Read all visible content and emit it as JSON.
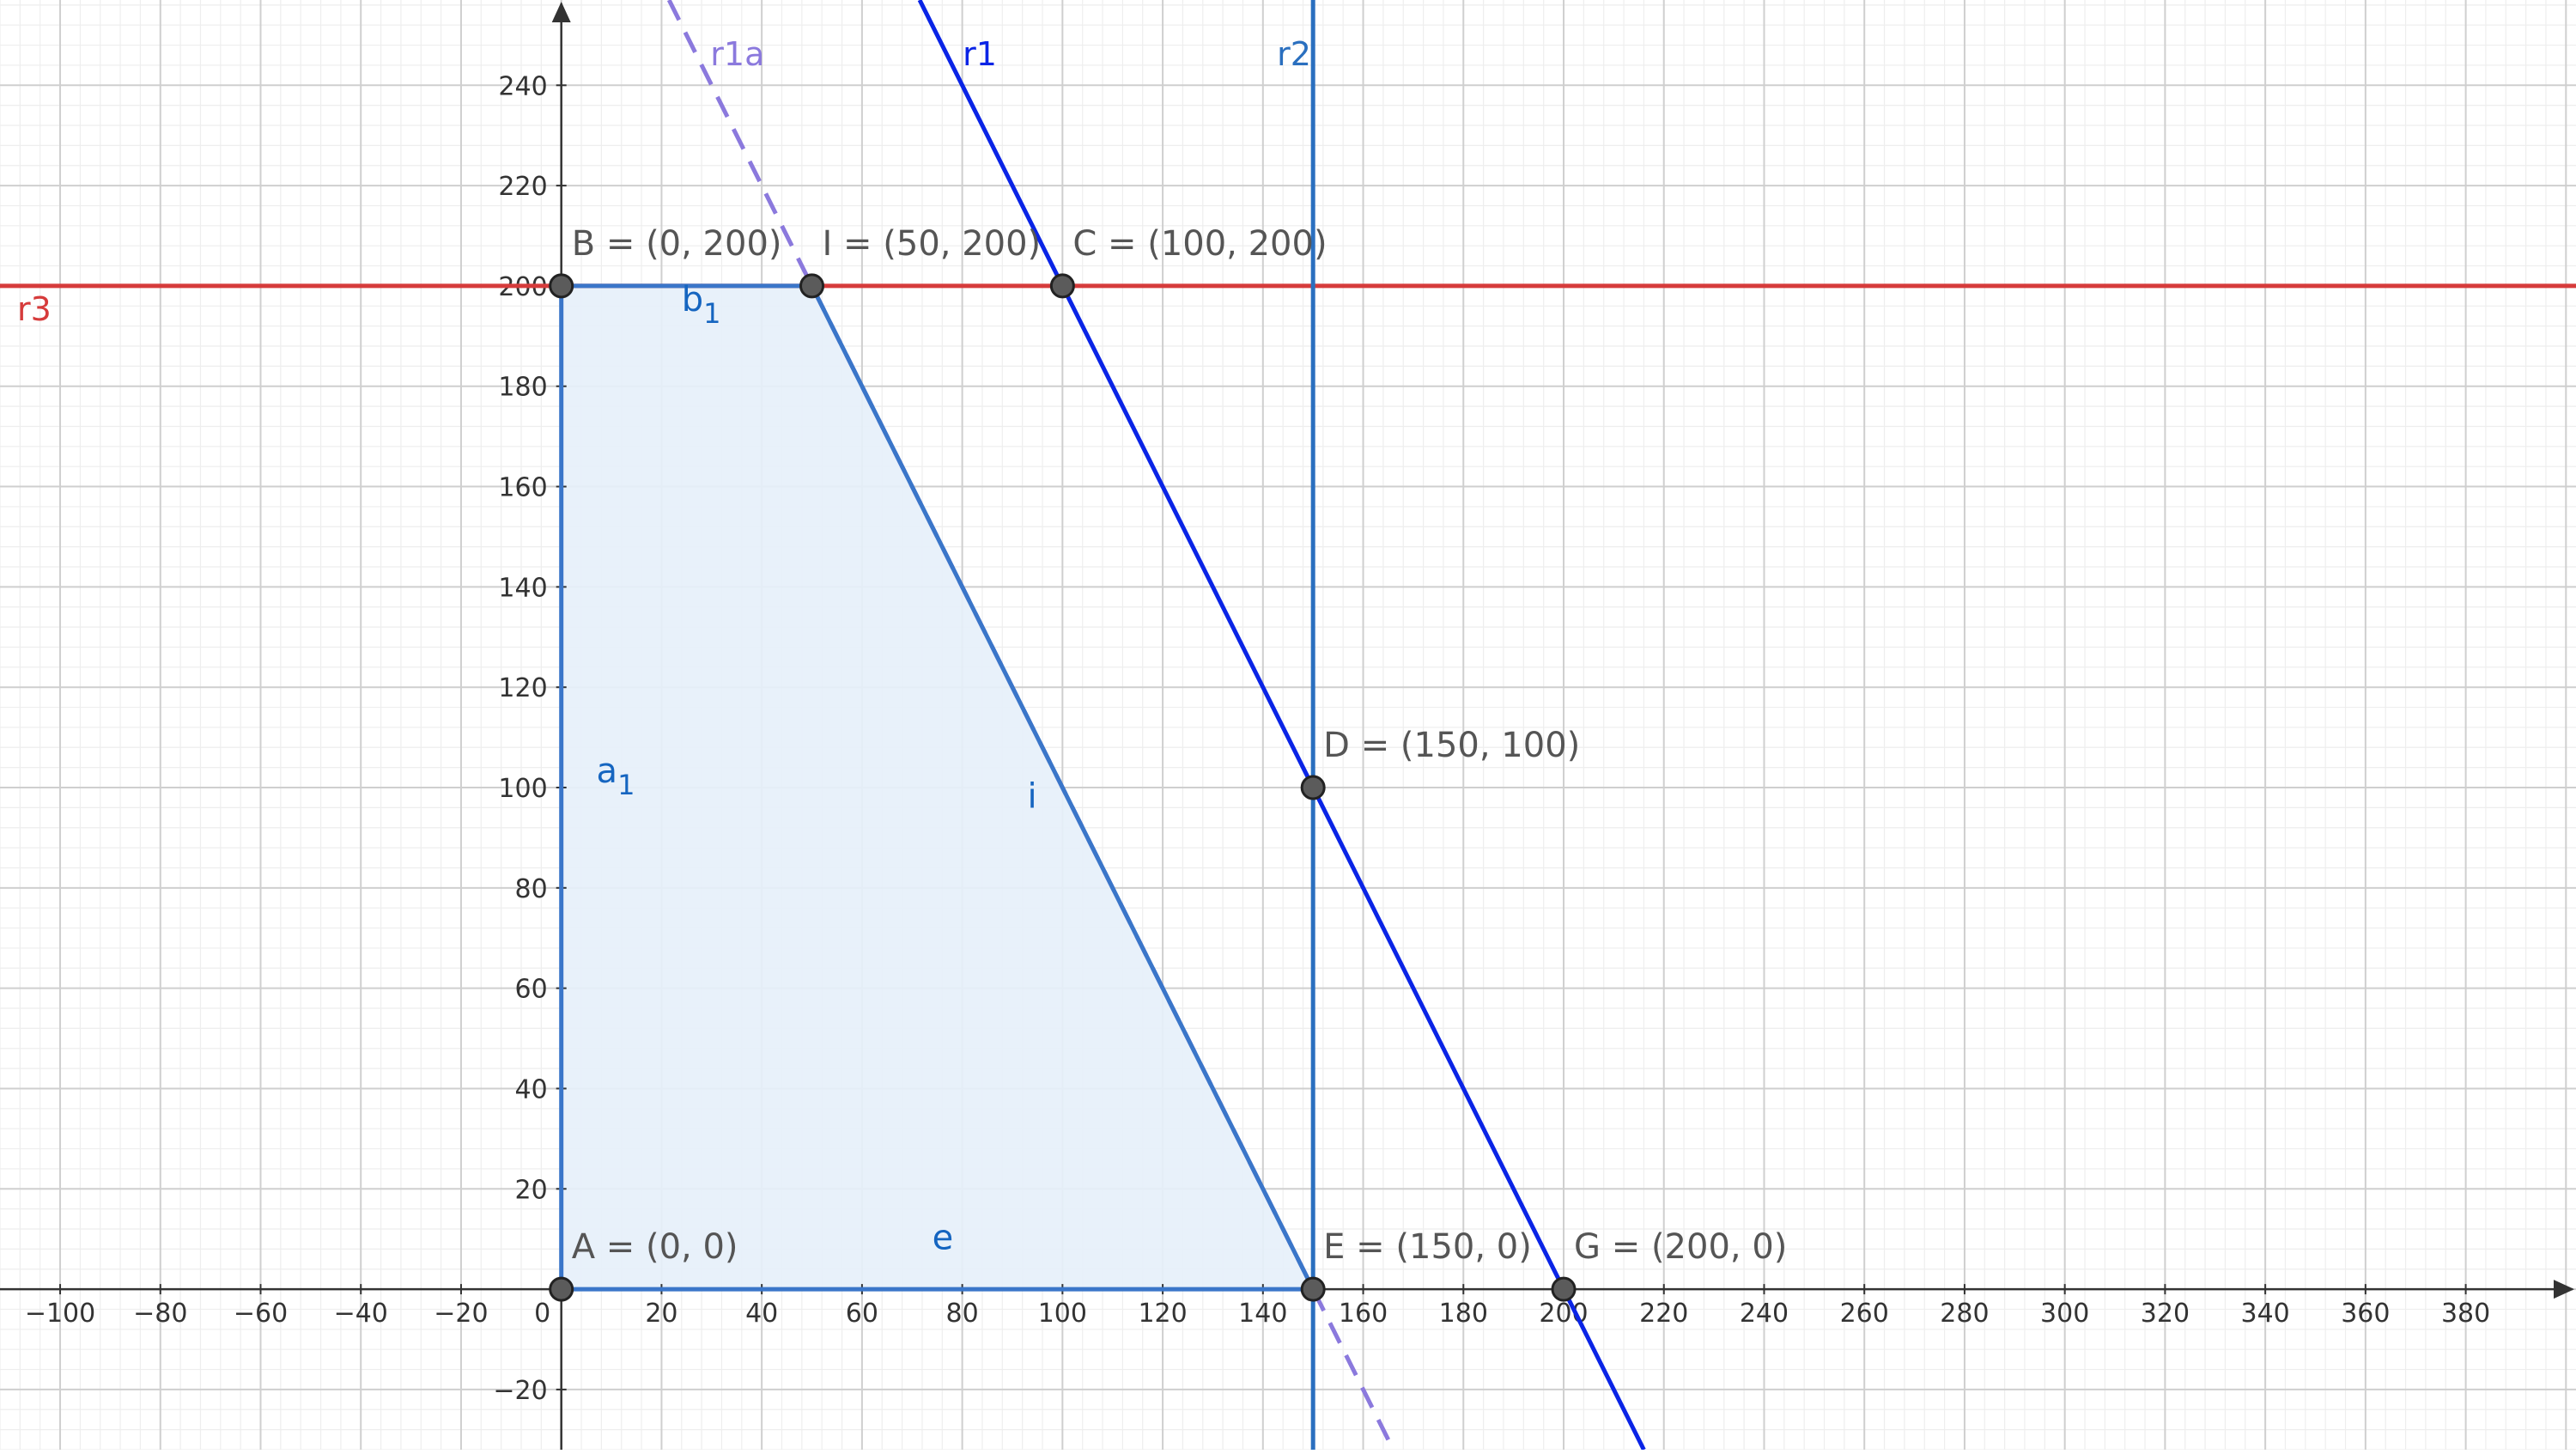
{
  "app": "GeoGebra Graphing",
  "colors": {
    "grid_minor": "#eeeeee",
    "grid_major": "#cfcfcf",
    "axis": "#333333",
    "region_fill": "#e6eff9",
    "region_edge": "#3a76c9",
    "r1": "#0a24e6",
    "r1a": "#8b79dd",
    "r2": "#2a6fbf",
    "r3": "#d63b3b",
    "point_fill": "#5b5b5b",
    "point_stroke": "#222222"
  },
  "axes": {
    "x_ticks": [
      "−100",
      "−80",
      "−60",
      "−40",
      "−20",
      "0",
      "20",
      "40",
      "60",
      "80",
      "100",
      "120",
      "140",
      "160",
      "180",
      "200",
      "220",
      "240",
      "260",
      "280",
      "300",
      "320",
      "340",
      "360",
      "380"
    ],
    "x_tick_values": [
      -100,
      -80,
      -60,
      -40,
      -20,
      0,
      20,
      40,
      60,
      80,
      100,
      120,
      140,
      160,
      180,
      200,
      220,
      240,
      260,
      280,
      300,
      320,
      340,
      360,
      380
    ],
    "y_ticks": [
      "−20",
      "20",
      "40",
      "60",
      "80",
      "100",
      "120",
      "140",
      "160",
      "180",
      "200",
      "220",
      "240"
    ],
    "y_tick_values": [
      -20,
      20,
      40,
      60,
      80,
      100,
      120,
      140,
      160,
      180,
      200,
      220,
      240
    ],
    "x_range": [
      -112,
      402
    ],
    "y_range": [
      -32,
      257
    ]
  },
  "lines": {
    "r1": {
      "label": "r1",
      "equation": "2x + y = 400",
      "style": "solid"
    },
    "r1a": {
      "label": "r1a",
      "equation": "2x + y = 300",
      "style": "dashed"
    },
    "r2": {
      "label": "r2",
      "equation": "x = 150",
      "style": "solid"
    },
    "r3": {
      "label": "r3",
      "equation": "y = 200",
      "style": "solid"
    }
  },
  "region": {
    "vertices": [
      [
        0,
        0
      ],
      [
        0,
        200
      ],
      [
        50,
        200
      ],
      [
        150,
        0
      ]
    ]
  },
  "segments": {
    "a1": {
      "label": "a",
      "sub": "1"
    },
    "b1": {
      "label": "b",
      "sub": "1"
    },
    "i": {
      "label": "i"
    },
    "e": {
      "label": "e"
    }
  },
  "points": [
    {
      "id": "A",
      "label": "A = (0, 0)",
      "x": 0,
      "y": 0
    },
    {
      "id": "B",
      "label": "B = (0, 200)",
      "x": 0,
      "y": 200
    },
    {
      "id": "I",
      "label": "I = (50, 200)",
      "x": 50,
      "y": 200
    },
    {
      "id": "C",
      "label": "C = (100, 200)",
      "x": 100,
      "y": 200
    },
    {
      "id": "D",
      "label": "D = (150, 100)",
      "x": 150,
      "y": 100
    },
    {
      "id": "E",
      "label": "E = (150, 0)",
      "x": 150,
      "y": 0
    },
    {
      "id": "G",
      "label": "G = (200, 0)",
      "x": 200,
      "y": 0
    }
  ]
}
